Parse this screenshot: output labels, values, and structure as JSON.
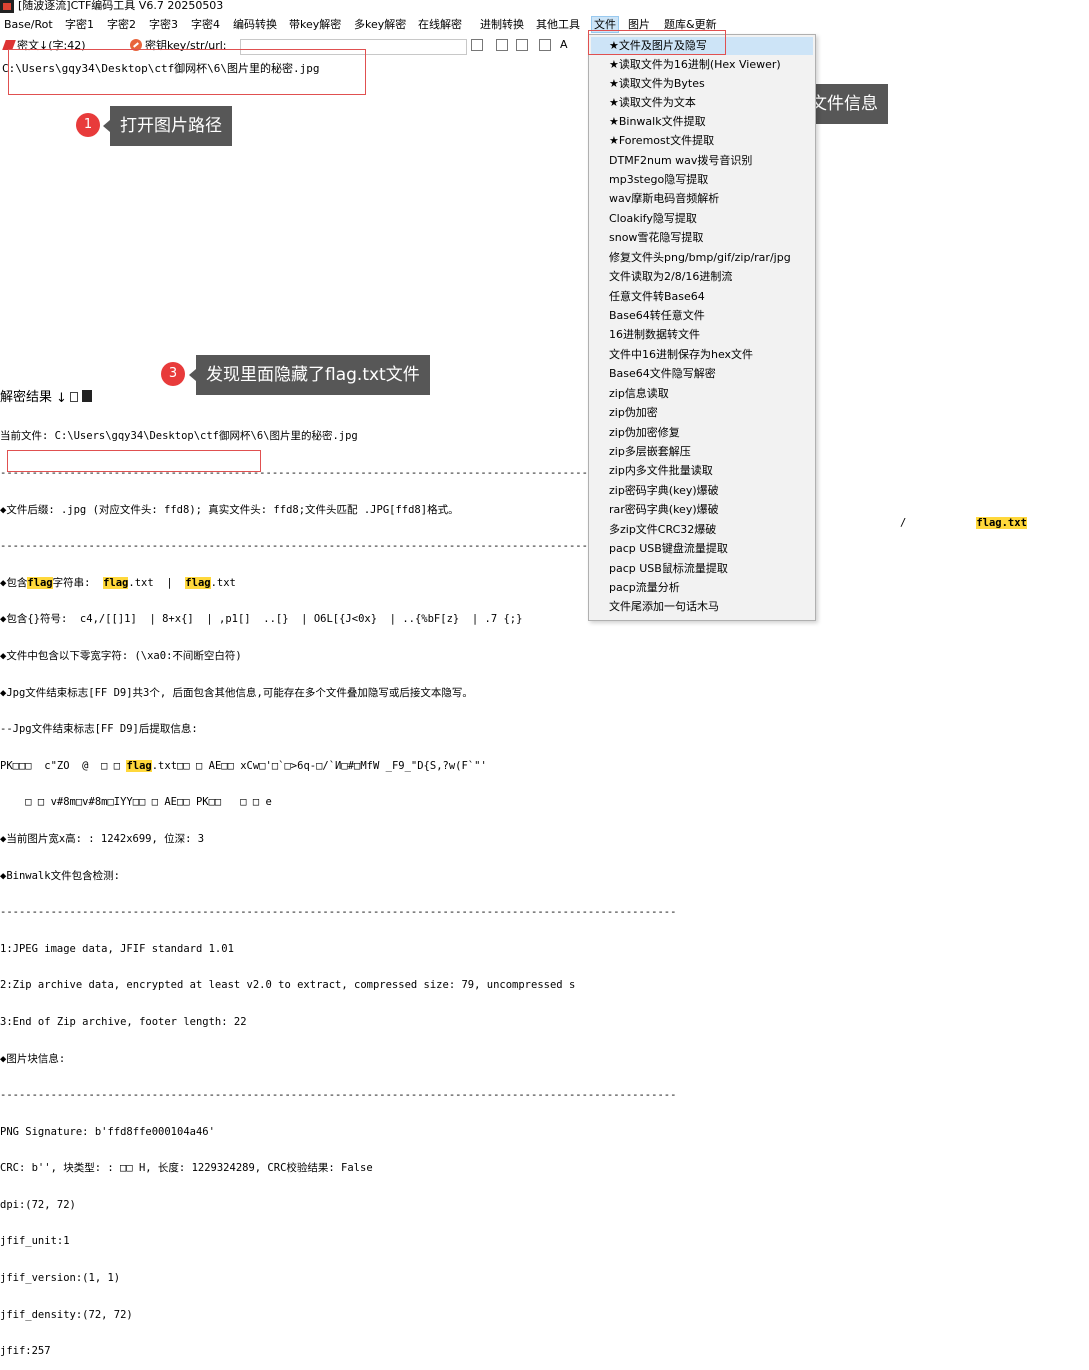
{
  "window": {
    "title": "[随波逐流]CTF编码工具 V6.7  20250503"
  },
  "menubar": {
    "items": [
      "Base/Rot",
      "字密1",
      "字密2",
      "字密3",
      "字密4",
      "编码转换",
      "带key解密",
      "多key解密",
      "在线解密",
      "进制转换",
      "其他工具",
      "文件",
      "图片",
      "题库&更新"
    ],
    "active": "文件"
  },
  "toolbar": {
    "plaintext_label": "密文↓(字:42)",
    "key_label": "密钥key/str/url:",
    "key_value": ""
  },
  "input": {
    "text": "C:\\Users\\gqy34\\Desktop\\ctf御网杯\\6\\图片里的秘密.jpg"
  },
  "callouts": [
    {
      "num": "1",
      "text": "打开图片路径"
    },
    {
      "num": "2",
      "text": "查看文件信息"
    },
    {
      "num": "3",
      "text": "发现里面隐藏了flag.txt文件"
    }
  ],
  "dropdown": {
    "items": [
      "★文件及图片及隐写",
      "★读取文件为16进制(Hex Viewer)",
      "★读取文件为Bytes",
      "★读取文件为文本",
      "★Binwalk文件提取",
      "★Foremost文件提取",
      "DTMF2num  wav拨号音识别",
      "mp3stego隐写提取",
      "wav摩斯电码音频解析",
      "Cloakify隐写提取",
      "snow雪花隐写提取",
      "修复文件头png/bmp/gif/zip/rar/jpg",
      "文件读取为2/8/16进制流",
      "任意文件转Base64",
      "Base64转任意文件",
      "16进制数据转文件",
      "文件中16进制保存为hex文件",
      "Base64文件隐写解密",
      "zip信息读取",
      "zip伪加密",
      "zip伪加密修复",
      "zip多层嵌套解压",
      "zip内多文件批量读取",
      "zip密码字典(key)爆破",
      "rar密码字典(key)爆破",
      "多zip文件CRC32爆破",
      "pacp USB键盘流量提取",
      "pacp USB鼠标流量提取",
      "pacp流量分析",
      "文件尾添加一句话木马"
    ],
    "selected_index": 0
  },
  "result": {
    "header": "解密结果",
    "lines": [
      "当前文件: C:\\Users\\gqy34\\Desktop\\ctf御网杯\\6\\图片里的秘密.jpg",
      "-----------------------------------------------------------------------------------------------------------",
      "◆文件后缀: .jpg (对应文件头: ffd8); 真实文件头: ffd8;文件头匹配 .JPG[ffd8]格式。",
      "-----------------------------------------------------------------------------------------------------------",
      "◆包含flag字符串:  flag.txt  |  flag.txt",
      "◆包含{}符号:  c4,/[[]1]  | 8+x{]  | ,p1[]  ..[}  | O6L[{J<0x}  | ..{%bF[z}  | .7 {;}",
      "◆文件中包含以下零宽字符: (\\xa0:不间断空白符)",
      "◆Jpg文件结束标志[FF D9]共3个, 后面包含其他信息,可能存在多个文件叠加隐写或后接文本隐写。",
      "--Jpg文件结束标志[FF D9]后提取信息:",
      "PK□□□  c\"ZO  @  □ □ flag.txt□□ □ AE□□ xCw□'□`□>6q-□/`И□#□MfW _F9_\"D{S,?w(F`\"'",
      "    □ □ v#8m□v#8m□IYY□□ □ AE□□ PK□□   □ □ e",
      "◆当前图片宽x高: : 1242x699, 位深: 3",
      "◆Binwalk文件包含检测:",
      "-----------------------------------------------------------------------------------------------------------",
      "1:JPEG image data, JFIF standard 1.01",
      "2:Zip archive data, encrypted at least v2.0 to extract, compressed size: 79, uncompressed s",
      "3:End of Zip archive, footer length: 22",
      "◆图片块信息:",
      "-----------------------------------------------------------------------------------------------------------",
      "PNG Signature: b'ffd8ffe000104a46'",
      "CRC: b'', 块类型: : □□ H, 长度: 1229324289, CRC校验结果: False",
      "dpi:(72, 72)",
      "jfif_unit:1",
      "jfif_version:(1, 1)",
      "jfif_density:(72, 72)",
      "jfif:257"
    ],
    "trailing_flag": "flag.txt",
    "trailing_slash": "/"
  }
}
